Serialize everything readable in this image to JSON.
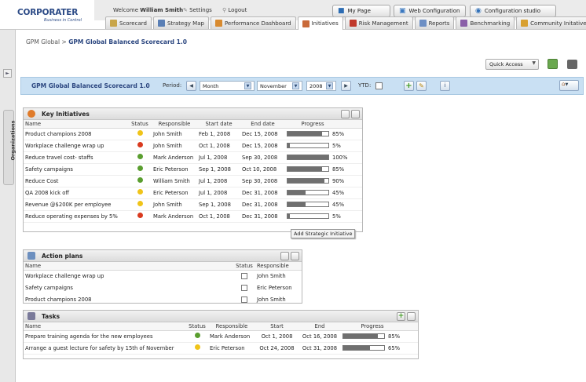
{
  "header": {
    "logo": "CORPORATER",
    "logo_sub": "Business in Control",
    "welcome_prefix": "Welcome",
    "user_name": "William Smith",
    "settings": "Settings",
    "logout": "Logout",
    "my_page": "My Page",
    "web_config": "Web Configuration",
    "config_studio": "Configuration studio"
  },
  "tabs": [
    {
      "label": "Scorecard",
      "color": "#c8a54a"
    },
    {
      "label": "Strategy Map",
      "color": "#5a7fb5"
    },
    {
      "label": "Performance Dashboard",
      "color": "#d88a2f"
    },
    {
      "label": "Initiatives",
      "color": "#c96a3a"
    },
    {
      "label": "Risk Management",
      "color": "#c0392b"
    },
    {
      "label": "Reports",
      "color": "#6d8fc4"
    },
    {
      "label": "Benchmarking",
      "color": "#8a5fa8"
    },
    {
      "label": "Community Initatives",
      "color": "#d8a030"
    }
  ],
  "sidebar": {
    "organizations": "Organizations"
  },
  "breadcrumb": {
    "root": "GPM Global",
    "separator": ">",
    "current": "GPM Global Balanced Scorecard 1.0"
  },
  "quick_access": "Quick Access",
  "scorecard_bar": {
    "title": "GPM Global Balanced Scorecard 1.0",
    "period_label": "Period:",
    "period_value": "Month",
    "month_value": "November",
    "year_value": "2008",
    "ytd_label": "YTD:"
  },
  "key_initiatives": {
    "title": "Key Initiatives",
    "columns": [
      "Name",
      "Status",
      "Responsible",
      "Start date",
      "End date",
      "Progress"
    ],
    "rows": [
      {
        "name": "Product champions 2008",
        "status": "yellow",
        "responsible": "John Smith",
        "start": "Feb 1, 2008",
        "end": "Dec 15, 2008",
        "progress": 85,
        "progress_label": "85%"
      },
      {
        "name": "Workplace challenge wrap up",
        "status": "red",
        "responsible": "John Smith",
        "start": "Oct 1, 2008",
        "end": "Dec 15, 2008",
        "progress": 5,
        "progress_label": "5%"
      },
      {
        "name": "Reduce travel cost- staffs",
        "status": "green",
        "responsible": "Mark Anderson",
        "start": "Jul 1, 2008",
        "end": "Sep 30, 2008",
        "progress": 100,
        "progress_label": "100%"
      },
      {
        "name": "Safety campaigns",
        "status": "green",
        "responsible": "Eric Peterson",
        "start": "Sep 1, 2008",
        "end": "Oct 10, 2008",
        "progress": 85,
        "progress_label": "85%"
      },
      {
        "name": "Reduce Cost",
        "status": "green",
        "responsible": "William Smith",
        "start": "Jul 1, 2008",
        "end": "Sep 30, 2008",
        "progress": 90,
        "progress_label": "90%"
      },
      {
        "name": "QA 2008 kick off",
        "status": "yellow",
        "responsible": "Eric Peterson",
        "start": "Jul 1, 2008",
        "end": "Dec 31, 2008",
        "progress": 45,
        "progress_label": "45%"
      },
      {
        "name": "Revenue @$200K per employee",
        "status": "yellow",
        "responsible": "John Smith",
        "start": "Sep 1, 2008",
        "end": "Dec 31, 2008",
        "progress": 45,
        "progress_label": "45%"
      },
      {
        "name": "Reduce operating expenses by 5%",
        "status": "red",
        "responsible": "Mark Anderson",
        "start": "Oct 1, 2008",
        "end": "Dec 31, 2008",
        "progress": 5,
        "progress_label": "5%"
      }
    ],
    "add_button": "Add Strategic Initiative"
  },
  "action_plans": {
    "title": "Action plans",
    "columns": [
      "Name",
      "Status",
      "Responsible"
    ],
    "rows": [
      {
        "name": "Workplace challenge wrap up",
        "responsible": "John Smith"
      },
      {
        "name": "Safety campaigns",
        "responsible": "Eric Peterson"
      },
      {
        "name": "Product champions 2008",
        "responsible": "John Smith"
      }
    ]
  },
  "tasks": {
    "title": "Tasks",
    "columns": [
      "Name",
      "Status",
      "Responsible",
      "Start",
      "End",
      "Progress"
    ],
    "rows": [
      {
        "name": "Prepare training agenda for the new employees",
        "status": "green",
        "responsible": "Mark Anderson",
        "start": "Oct 1, 2008",
        "end": "Oct 16, 2008",
        "progress": 85,
        "progress_label": "85%"
      },
      {
        "name": "Arrange a guest lecture for safety by 15th of November",
        "status": "yellow",
        "responsible": "Eric Peterson",
        "start": "Oct 24, 2008",
        "end": "Oct 31, 2008",
        "progress": 65,
        "progress_label": "65%"
      }
    ]
  },
  "status_colors": {
    "green": "#5a9e2f",
    "yellow": "#f0c419",
    "red": "#d93a1f"
  }
}
